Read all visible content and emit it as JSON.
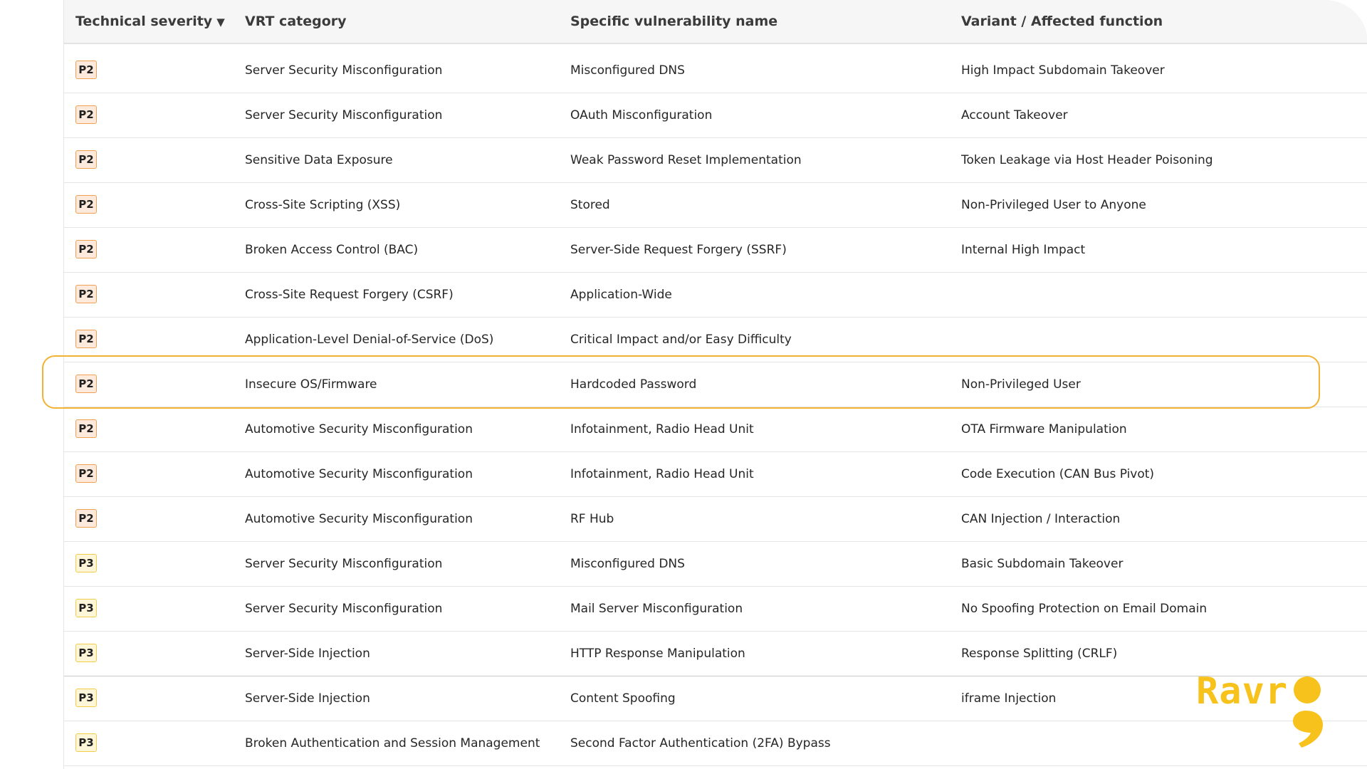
{
  "table": {
    "headers": {
      "severity": "Technical severity",
      "category": "VRT category",
      "name": "Specific vulnerability name",
      "variant": "Variant / Affected function"
    },
    "sort_indicator": "▼",
    "rows": [
      {
        "severity": "P2",
        "category": "Server Security Misconfiguration",
        "name": "Misconfigured DNS",
        "variant": "High Impact Subdomain Takeover"
      },
      {
        "severity": "P2",
        "category": "Server Security Misconfiguration",
        "name": "OAuth Misconfiguration",
        "variant": "Account Takeover"
      },
      {
        "severity": "P2",
        "category": "Sensitive Data Exposure",
        "name": "Weak Password Reset Implementation",
        "variant": "Token Leakage via Host Header Poisoning"
      },
      {
        "severity": "P2",
        "category": "Cross-Site Scripting (XSS)",
        "name": "Stored",
        "variant": "Non-Privileged User to Anyone"
      },
      {
        "severity": "P2",
        "category": "Broken Access Control (BAC)",
        "name": "Server-Side Request Forgery (SSRF)",
        "variant": "Internal High Impact"
      },
      {
        "severity": "P2",
        "category": "Cross-Site Request Forgery (CSRF)",
        "name": "Application-Wide",
        "variant": ""
      },
      {
        "severity": "P2",
        "category": "Application-Level Denial-of-Service (DoS)",
        "name": "Critical Impact and/or Easy Difficulty",
        "variant": ""
      },
      {
        "severity": "P2",
        "category": "Insecure OS/Firmware",
        "name": "Hardcoded Password",
        "variant": "Non-Privileged User"
      },
      {
        "severity": "P2",
        "category": "Automotive Security Misconfiguration",
        "name": "Infotainment, Radio Head Unit",
        "variant": "OTA Firmware Manipulation"
      },
      {
        "severity": "P2",
        "category": "Automotive Security Misconfiguration",
        "name": "Infotainment, Radio Head Unit",
        "variant": "Code Execution (CAN Bus Pivot)"
      },
      {
        "severity": "P2",
        "category": "Automotive Security Misconfiguration",
        "name": "RF Hub",
        "variant": "CAN Injection / Interaction"
      },
      {
        "severity": "P3",
        "category": "Server Security Misconfiguration",
        "name": "Misconfigured DNS",
        "variant": "Basic Subdomain Takeover"
      },
      {
        "severity": "P3",
        "category": "Server Security Misconfiguration",
        "name": "Mail Server Misconfiguration",
        "variant": "No Spoofing Protection on Email Domain"
      },
      {
        "severity": "P3",
        "category": "Server-Side Injection",
        "name": "HTTP Response Manipulation",
        "variant": "Response Splitting (CRLF)"
      },
      {
        "severity": "P3",
        "category": "Server-Side Injection",
        "name": "Content Spoofing",
        "variant": "iframe Injection"
      },
      {
        "severity": "P3",
        "category": "Broken Authentication and Session Management",
        "name": "Second Factor Authentication (2FA) Bypass",
        "variant": ""
      }
    ],
    "highlighted_row_index": 7
  },
  "logo": {
    "text": "Ravr"
  },
  "colors": {
    "p2_border": "#f0a052",
    "p2_fill": "#fdeadc",
    "p3_border": "#f2cd4a",
    "p3_fill": "#fdf6d9",
    "highlight": "#f2b233",
    "logo": "#f7c21b"
  }
}
